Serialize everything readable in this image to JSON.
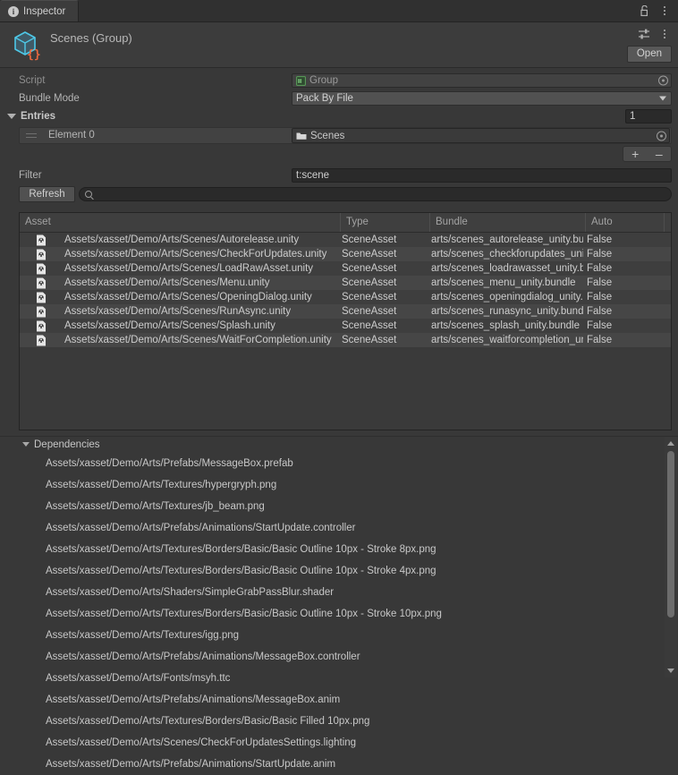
{
  "window": {
    "tab_label": "Inspector",
    "tab_icon": "info-icon",
    "lock_icon": "lock-icon",
    "tab_menu_icon": "kebab-menu-icon",
    "preset_icon": "preset-settings-icon",
    "header_menu_icon": "kebab-menu-icon"
  },
  "header": {
    "title": "Scenes (Group)",
    "object_icon": "script-asset-cube-icon",
    "open_label": "Open"
  },
  "properties": {
    "script": {
      "label": "Script",
      "value": "Group",
      "icon": "cs-script-icon",
      "picker_icon": "object-picker-icon"
    },
    "bundle_mode": {
      "label": "Bundle Mode",
      "value": "Pack By File",
      "caret_icon": "chevron-down-icon"
    },
    "entries": {
      "label": "Entries",
      "foldout_icon": "foldout-expanded-icon",
      "size": "1",
      "element": {
        "label": "Element 0",
        "value": "Scenes",
        "icon": "folder-icon",
        "drag_handle_icon": "drag-handle-icon",
        "picker_icon": "object-picker-icon"
      },
      "add_label": "+",
      "remove_label": "–"
    },
    "filter": {
      "label": "Filter",
      "value": "t:scene"
    },
    "refresh": {
      "label": "Refresh",
      "search_placeholder": "",
      "search_value": "",
      "search_icon": "search-icon"
    }
  },
  "asset_table": {
    "columns": [
      {
        "key": "asset",
        "label": "Asset"
      },
      {
        "key": "type",
        "label": "Type"
      },
      {
        "key": "bundle",
        "label": "Bundle"
      },
      {
        "key": "auto",
        "label": "Auto"
      }
    ],
    "rows": [
      {
        "icon": "scene-asset-icon",
        "asset": "Assets/xasset/Demo/Arts/Scenes/Autorelease.unity",
        "type": "SceneAsset",
        "bundle": "arts/scenes_autorelease_unity.bundle",
        "auto": "False"
      },
      {
        "icon": "scene-asset-icon",
        "asset": "Assets/xasset/Demo/Arts/Scenes/CheckForUpdates.unity",
        "type": "SceneAsset",
        "bundle": "arts/scenes_checkforupdates_unity.bundle",
        "auto": "False"
      },
      {
        "icon": "scene-asset-icon",
        "asset": "Assets/xasset/Demo/Arts/Scenes/LoadRawAsset.unity",
        "type": "SceneAsset",
        "bundle": "arts/scenes_loadrawasset_unity.bundle",
        "auto": "False"
      },
      {
        "icon": "scene-asset-icon",
        "asset": "Assets/xasset/Demo/Arts/Scenes/Menu.unity",
        "type": "SceneAsset",
        "bundle": "arts/scenes_menu_unity.bundle",
        "auto": "False"
      },
      {
        "icon": "scene-asset-icon",
        "asset": "Assets/xasset/Demo/Arts/Scenes/OpeningDialog.unity",
        "type": "SceneAsset",
        "bundle": "arts/scenes_openingdialog_unity.bundle",
        "auto": "False"
      },
      {
        "icon": "scene-asset-icon",
        "asset": "Assets/xasset/Demo/Arts/Scenes/RunAsync.unity",
        "type": "SceneAsset",
        "bundle": "arts/scenes_runasync_unity.bundle",
        "auto": "False"
      },
      {
        "icon": "scene-asset-icon",
        "asset": "Assets/xasset/Demo/Arts/Scenes/Splash.unity",
        "type": "SceneAsset",
        "bundle": "arts/scenes_splash_unity.bundle",
        "auto": "False"
      },
      {
        "icon": "scene-asset-icon",
        "asset": "Assets/xasset/Demo/Arts/Scenes/WaitForCompletion.unity",
        "type": "SceneAsset",
        "bundle": "arts/scenes_waitforcompletion_unity.bundle",
        "auto": "False"
      }
    ]
  },
  "dependencies": {
    "title": "Dependencies",
    "foldout_icon": "foldout-expanded-icon",
    "items": [
      "Assets/xasset/Demo/Arts/Prefabs/MessageBox.prefab",
      "Assets/xasset/Demo/Arts/Textures/hypergryph.png",
      "Assets/xasset/Demo/Arts/Textures/jb_beam.png",
      "Assets/xasset/Demo/Arts/Prefabs/Animations/StartUpdate.controller",
      "Assets/xasset/Demo/Arts/Textures/Borders/Basic/Basic Outline 10px - Stroke 8px.png",
      "Assets/xasset/Demo/Arts/Textures/Borders/Basic/Basic Outline 10px - Stroke 4px.png",
      "Assets/xasset/Demo/Arts/Shaders/SimpleGrabPassBlur.shader",
      "Assets/xasset/Demo/Arts/Textures/Borders/Basic/Basic Outline 10px - Stroke 10px.png",
      "Assets/xasset/Demo/Arts/Textures/igg.png",
      "Assets/xasset/Demo/Arts/Prefabs/Animations/MessageBox.controller",
      "Assets/xasset/Demo/Arts/Fonts/msyh.ttc",
      "Assets/xasset/Demo/Arts/Prefabs/Animations/MessageBox.anim",
      "Assets/xasset/Demo/Arts/Textures/Borders/Basic/Basic Filled 10px.png",
      "Assets/xasset/Demo/Arts/Scenes/CheckForUpdatesSettings.lighting",
      "Assets/xasset/Demo/Arts/Prefabs/Animations/StartUpdate.anim"
    ],
    "scrollbar": {
      "up_icon": "scroll-up-arrow-icon",
      "down_icon": "scroll-down-arrow-icon",
      "thumb": "scrollbar-thumb"
    }
  },
  "colors": {
    "window_bg": "#383838",
    "panel_bg": "#3c3c3c",
    "row_even": "#3e3e3e",
    "row_odd": "#464646",
    "text": "#c8c8c8",
    "accent_script_icon": "#4a8f4a",
    "accent_cube_orange": "#e8683f",
    "accent_cube_blue": "#4ec9e8"
  }
}
